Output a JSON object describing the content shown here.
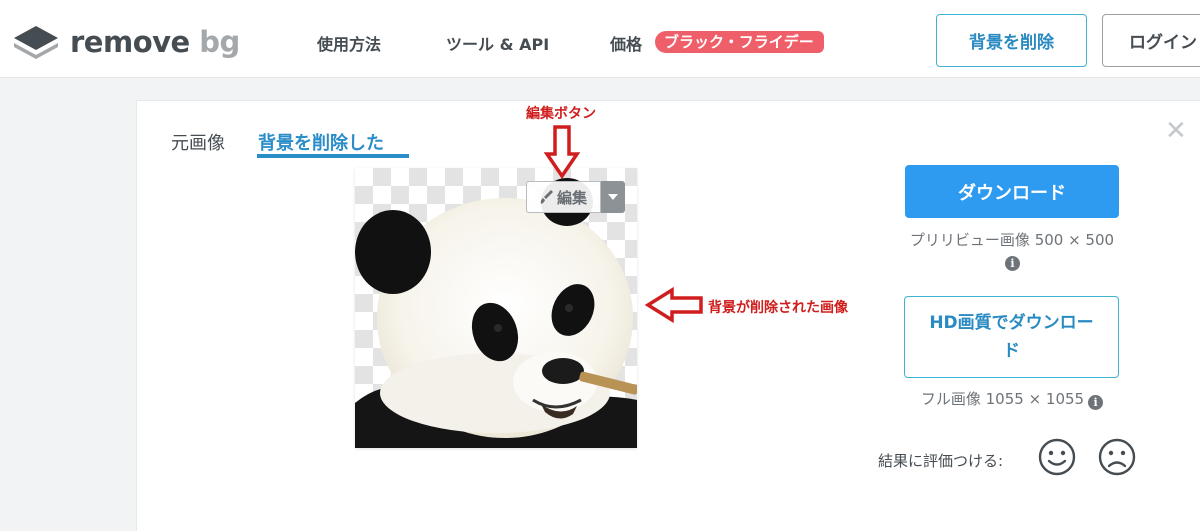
{
  "header": {
    "logo": {
      "icon": "removebg-layers-icon",
      "word_remove": "remove",
      "word_bg": "bg"
    },
    "nav": [
      {
        "label": "使用方法"
      },
      {
        "label": "ツール & API"
      },
      {
        "label": "価格"
      }
    ],
    "nav_badge": "ブラック・フライデー",
    "remove_bg_button": "背景を削除",
    "login_button": "ログイン"
  },
  "tabs": {
    "original": "元画像",
    "removed": "背景を削除した"
  },
  "image": {
    "edit_label": "編集",
    "edit_icon": "brush-icon",
    "caret_icon": "caret-down-icon"
  },
  "download": {
    "button": "ダウンロード",
    "preview_meta": "プリリビュー画像 500 × 500",
    "info_icon": "info-icon",
    "hd_button": "HD画質でダウンロード",
    "full_meta": "フル画像 1055 × 1055"
  },
  "rating": {
    "label": "結果に評価つける:",
    "happy_icon": "smile-icon",
    "sad_icon": "frown-icon"
  },
  "annotations": {
    "edit_button_note": "編集ボタン",
    "result_image_note": "背景が削除された画像",
    "color": "#d01e1e"
  },
  "colors": {
    "accent_blue": "#2e9bf0",
    "tab_blue": "#2b8dc8",
    "badge_red": "#ef5f69"
  }
}
